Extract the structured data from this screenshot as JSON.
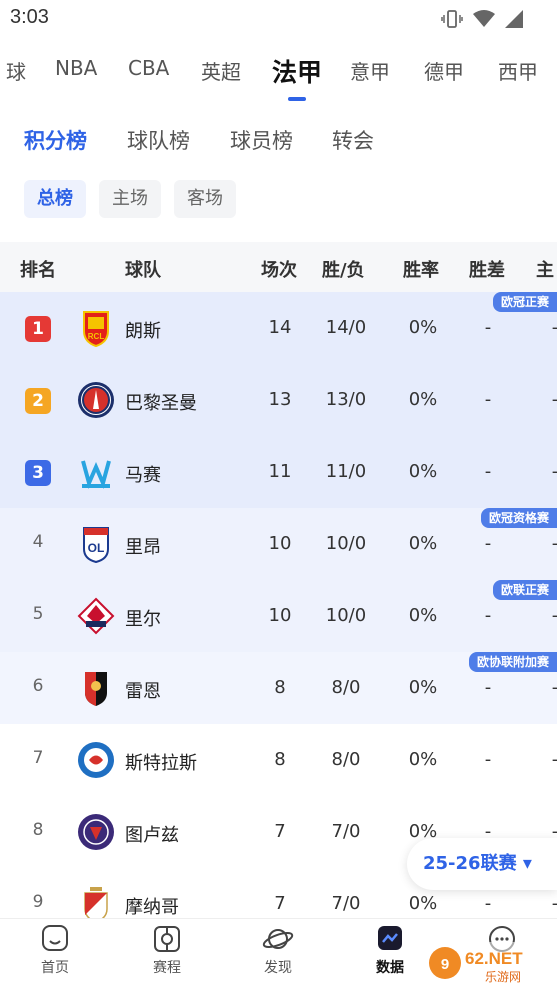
{
  "status": {
    "time": "3:03"
  },
  "league_tabs": [
    "球",
    "NBA",
    "CBA",
    "英超",
    "法甲",
    "意甲",
    "德甲",
    "西甲"
  ],
  "sub_tabs": [
    "积分榜",
    "球队榜",
    "球员榜",
    "转会"
  ],
  "filters": [
    "总榜",
    "主场",
    "客场"
  ],
  "columns": [
    "排名",
    "球队",
    "场次",
    "胜/负",
    "胜率",
    "胜差",
    "主"
  ],
  "rows": [
    {
      "rank": "1",
      "team": "朗斯",
      "played": "14",
      "wl": "14/0",
      "pct": "0%",
      "gb": "-",
      "home": "-",
      "tag": "欧冠正赛"
    },
    {
      "rank": "2",
      "team": "巴黎圣曼",
      "played": "13",
      "wl": "13/0",
      "pct": "0%",
      "gb": "-",
      "home": "-",
      "tag": ""
    },
    {
      "rank": "3",
      "team": "马赛",
      "played": "11",
      "wl": "11/0",
      "pct": "0%",
      "gb": "-",
      "home": "-",
      "tag": ""
    },
    {
      "rank": "4",
      "team": "里昂",
      "played": "10",
      "wl": "10/0",
      "pct": "0%",
      "gb": "-",
      "home": "-",
      "tag": "欧冠资格赛"
    },
    {
      "rank": "5",
      "team": "里尔",
      "played": "10",
      "wl": "10/0",
      "pct": "0%",
      "gb": "-",
      "home": "-",
      "tag": "欧联正赛"
    },
    {
      "rank": "6",
      "team": "雷恩",
      "played": "8",
      "wl": "8/0",
      "pct": "0%",
      "gb": "-",
      "home": "-",
      "tag": "欧协联附加赛"
    },
    {
      "rank": "7",
      "team": "斯特拉斯",
      "played": "8",
      "wl": "8/0",
      "pct": "0%",
      "gb": "-",
      "home": "-",
      "tag": ""
    },
    {
      "rank": "8",
      "team": "图卢兹",
      "played": "7",
      "wl": "7/0",
      "pct": "0%",
      "gb": "-",
      "home": "-",
      "tag": ""
    },
    {
      "rank": "9",
      "team": "摩纳哥",
      "played": "7",
      "wl": "7/0",
      "pct": "0%",
      "gb": "-",
      "home": "-",
      "tag": ""
    }
  ],
  "season_selector": "25-26联赛 ▾",
  "bottom_nav": [
    "首页",
    "赛程",
    "发现",
    "数据",
    ""
  ],
  "watermark": "962.NET 乐游网",
  "colors": {
    "accent": "#2f63e6",
    "rank1": "#e53935",
    "rank2": "#f5a623",
    "rank3": "#3d6ae6",
    "tag": "#4f7de8"
  }
}
